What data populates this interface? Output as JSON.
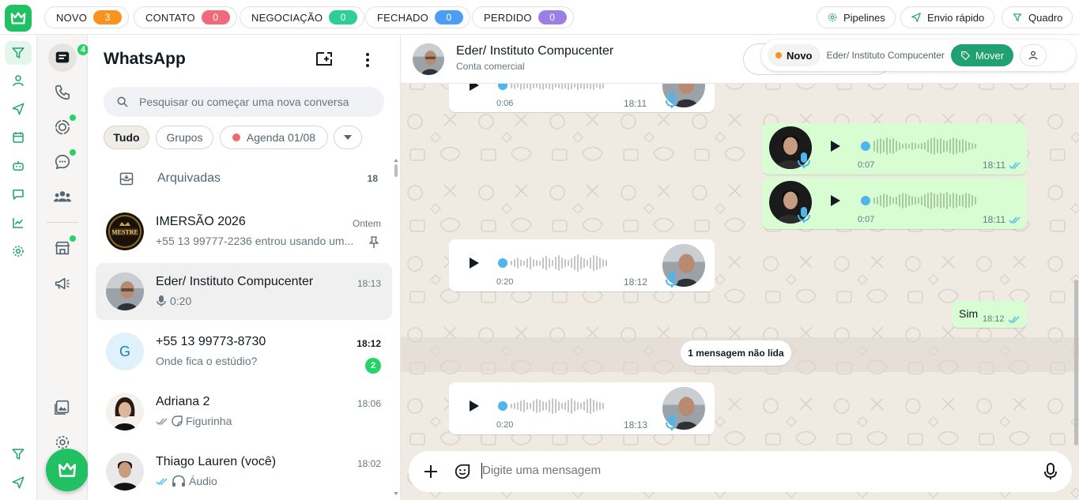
{
  "pipeline": {
    "stages": [
      {
        "label": "NOVO",
        "count": "3",
        "color": "#f7931e"
      },
      {
        "label": "CONTATO",
        "count": "0",
        "color": "#f06a7b"
      },
      {
        "label": "NEGOCIAÇÃO",
        "count": "0",
        "color": "#2dcf95"
      },
      {
        "label": "FECHADO",
        "count": "0",
        "color": "#4a9ff5"
      },
      {
        "label": "PERDIDO",
        "count": "0",
        "color": "#9b7fe6"
      }
    ],
    "pipelines_label": "Pipelines",
    "envio_label": "Envio rápido",
    "quadro_label": "Quadro"
  },
  "rail2": {
    "chats_badge": "4"
  },
  "list": {
    "title": "WhatsApp",
    "search_placeholder": "Pesquisar ou começar uma nova conversa",
    "filters": [
      "Tudo",
      "Grupos",
      "Agenda 01/08"
    ],
    "archived_label": "Arquivadas",
    "archived_count": "18",
    "chats": [
      {
        "name": "IMERSÃO 2026",
        "time": "Ontem",
        "preview": "+55 13 99777-2236 entrou usando um..."
      },
      {
        "name": "Eder/ Instituto Compucenter",
        "time": "18:13",
        "preview": "0:20"
      },
      {
        "name": "+55 13 99773-8730",
        "time": "18:12",
        "preview": "Onde fica o estúdio?",
        "unread": "2",
        "initial": "G"
      },
      {
        "name": "Adriana 2",
        "time": "18:06",
        "preview": "Figurinha"
      },
      {
        "name": "Thiago Lauren (você)",
        "time": "18:02",
        "preview": "Áudio"
      }
    ]
  },
  "chat": {
    "name": "Eder/ Instituto Compucenter",
    "subtitle": "Conta comercial",
    "crm_stage": "Novo",
    "crm_name": "Eder/ Instituto Compucenter",
    "crm_move": "Mover",
    "messages": [
      {
        "dir": "in",
        "duration": "0:06",
        "time": "18:11"
      },
      {
        "dir": "out",
        "duration": "0:07",
        "time": "18:11"
      },
      {
        "dir": "out",
        "duration": "0:07",
        "time": "18:11"
      },
      {
        "dir": "in",
        "duration": "0:20",
        "time": "18:12"
      },
      {
        "dir": "out",
        "text": "Sim",
        "time": "18:12"
      },
      {
        "dir": "in",
        "duration": "0:20",
        "time": "18:13"
      }
    ],
    "unread_divider": "1 mensagem não lida",
    "composer_placeholder": "Digite uma mensagem"
  },
  "colors": {
    "accent": "#21c063",
    "outgoing": "#d9fdd3",
    "wallpaper": "#efeae2"
  }
}
